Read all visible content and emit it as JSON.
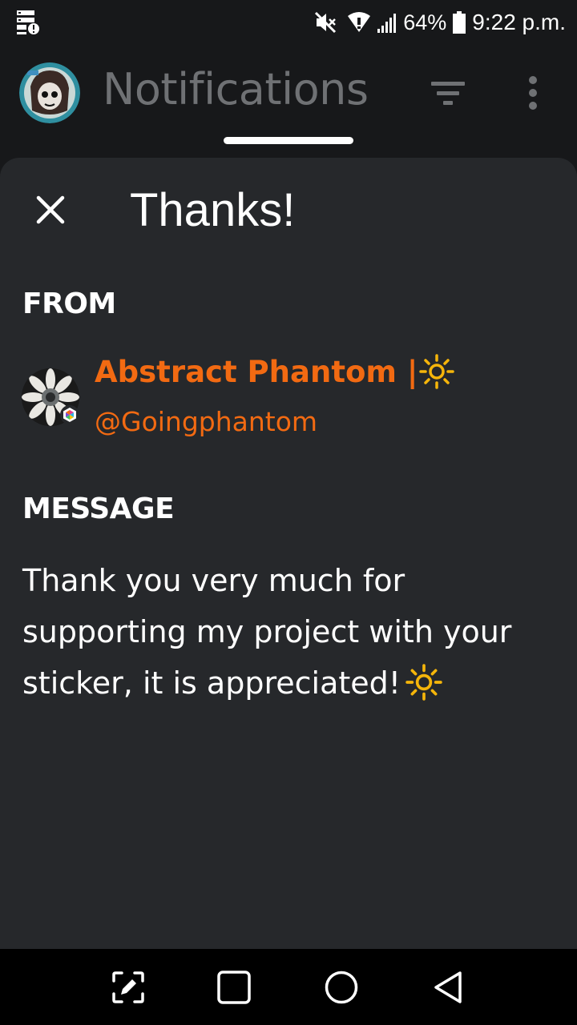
{
  "status_bar": {
    "notification_icon": "server-alert-icon",
    "mute_icon": "vibrate-off-icon",
    "wifi_icon": "wifi-icon",
    "signal_icon": "signal-icon",
    "battery_percent": "64%",
    "battery_icon": "battery-icon",
    "time": "9:22 p.m."
  },
  "header": {
    "title": "Notifications",
    "avatar_icon": "profile-avatar",
    "filter_icon": "filter-icon",
    "more_icon": "more-vert-icon"
  },
  "sheet": {
    "title": "Thanks!",
    "close_icon": "close-icon",
    "from_label": "FROM",
    "sender": {
      "name": "Abstract Phantom |",
      "name_emoji": "sun-emoji",
      "handle": "@Goingphantom"
    },
    "message_label": "MESSAGE",
    "message": "Thank you very much for supporting my project with your sticker, it is appreciated!",
    "message_emoji": "sun-emoji"
  },
  "nav_bar": {
    "items": [
      "edit-screenshot-icon",
      "recents-icon",
      "home-icon",
      "back-icon"
    ]
  },
  "colors": {
    "background": "#17181a",
    "sheet": "#26282b",
    "accent": "#f26a12",
    "title_muted": "#6f7174",
    "sun": "#f5b50a"
  }
}
